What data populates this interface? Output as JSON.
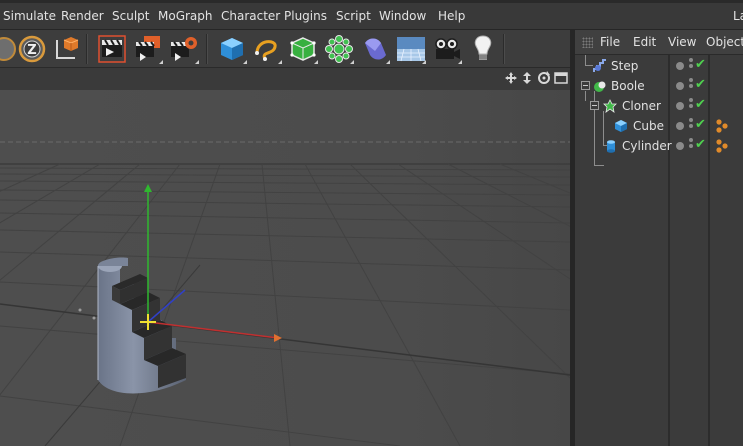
{
  "menubar": {
    "items": [
      "Simulate",
      "Render",
      "Sculpt",
      "MoGraph",
      "Character",
      "Plugins",
      "Script",
      "Window",
      "Help"
    ],
    "right_label": "La"
  },
  "toolbar": {
    "buttons": [
      {
        "icon": "z-axis-lock-icon"
      },
      {
        "icon": "world-coordinates-icon"
      },
      {
        "icon": "render-view-icon"
      },
      {
        "icon": "render-to-picture-viewer-icon"
      },
      {
        "icon": "render-settings-icon"
      },
      {
        "icon": "cube-primitive-icon"
      },
      {
        "icon": "spline-pen-icon"
      },
      {
        "icon": "nurbs-generator-icon"
      },
      {
        "icon": "array-mograph-icon"
      },
      {
        "icon": "deformer-icon"
      },
      {
        "icon": "floor-environment-icon"
      },
      {
        "icon": "camera-icon"
      },
      {
        "icon": "light-icon"
      }
    ]
  },
  "viewport": {
    "nav_icons": [
      "move-view-icon",
      "dolly-view-icon",
      "rotate-view-icon",
      "toggle-panel-icon"
    ]
  },
  "object_manager": {
    "menu": [
      "File",
      "Edit",
      "View",
      "Objects"
    ],
    "objects": [
      {
        "name": "Step",
        "icon": "step-effector-icon",
        "depth": 0,
        "tags": false
      },
      {
        "name": "Boole",
        "icon": "boole-icon",
        "depth": 0,
        "tags": false
      },
      {
        "name": "Cloner",
        "icon": "cloner-icon",
        "depth": 1,
        "tags": false
      },
      {
        "name": "Cube",
        "icon": "cube-object-icon",
        "depth": 2,
        "tags": true
      },
      {
        "name": "Cylinder",
        "icon": "cylinder-object-icon",
        "depth": 1,
        "tags": true
      }
    ],
    "check_glyph": "✔"
  }
}
